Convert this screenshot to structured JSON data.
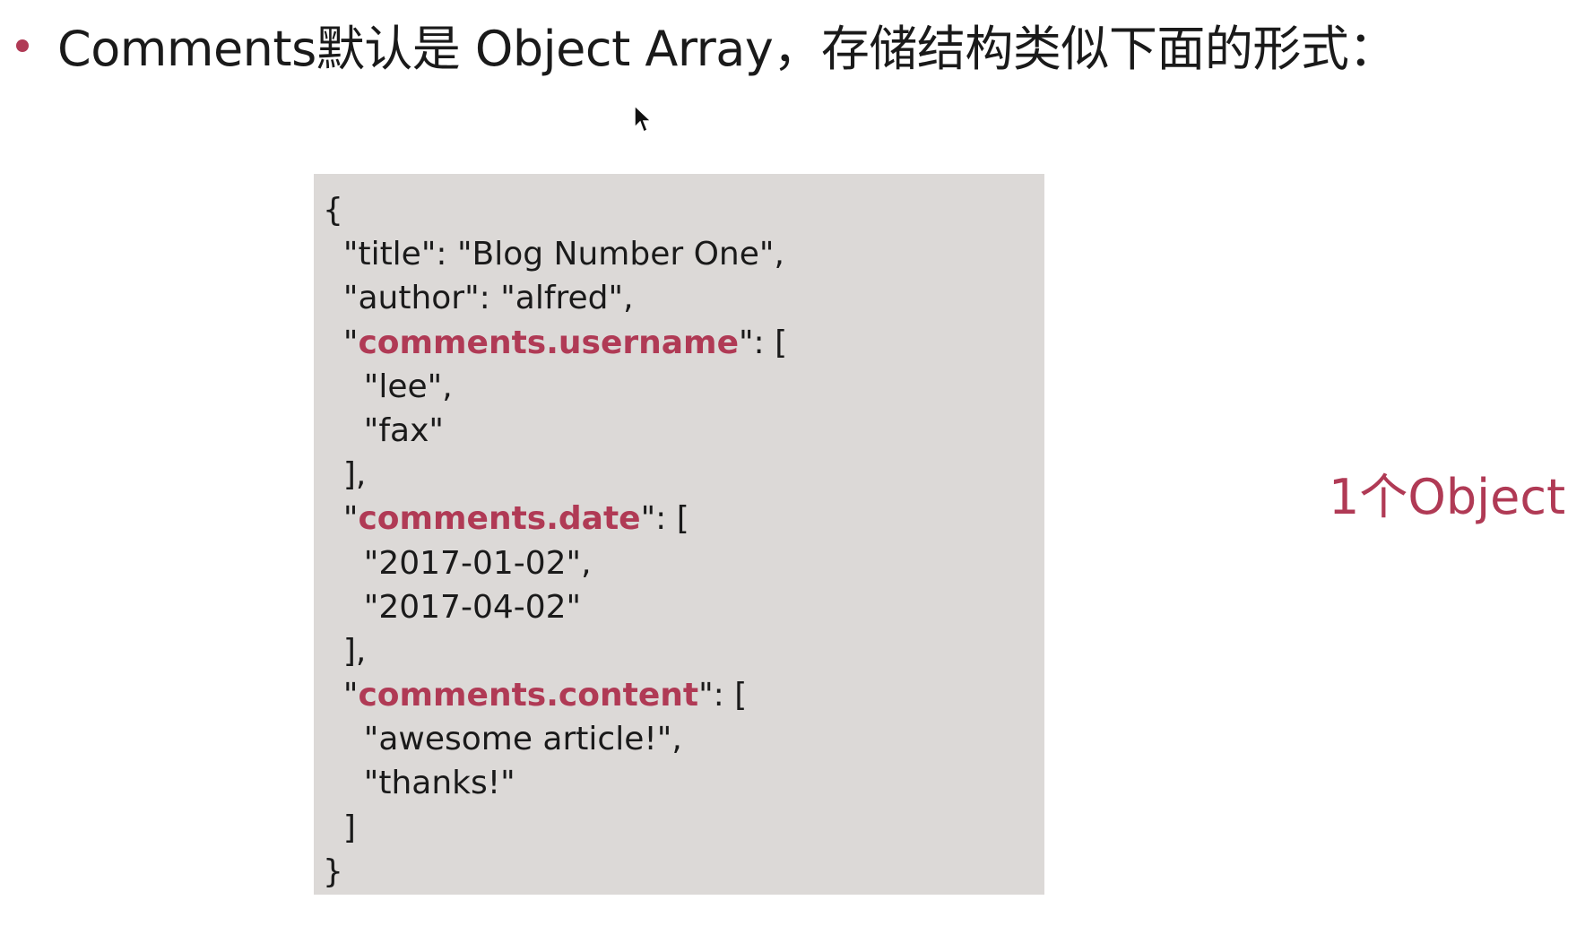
{
  "heading": "Comments默认是 Object Array，存储结构类似下面的形式：",
  "side_label": "1个Object",
  "colors": {
    "accent": "#b03a55",
    "code_bg": "#dcd9d7",
    "text": "#1a1a1a"
  },
  "code": {
    "lines": [
      {
        "indent": "",
        "pre": "{",
        "key": "",
        "post": ""
      },
      {
        "indent": "  ",
        "pre": "\"title\": \"Blog Number One\",",
        "key": "",
        "post": ""
      },
      {
        "indent": "  ",
        "pre": "\"author\": \"alfred\",",
        "key": "",
        "post": ""
      },
      {
        "indent": "  ",
        "pre": "\"",
        "key": "comments.username",
        "post": "\": ["
      },
      {
        "indent": "    ",
        "pre": "\"lee\",",
        "key": "",
        "post": ""
      },
      {
        "indent": "    ",
        "pre": "\"fax\"",
        "key": "",
        "post": ""
      },
      {
        "indent": "  ",
        "pre": "],",
        "key": "",
        "post": ""
      },
      {
        "indent": "  ",
        "pre": "\"",
        "key": "comments.date",
        "post": "\": ["
      },
      {
        "indent": "    ",
        "pre": "\"2017-01-02\",",
        "key": "",
        "post": ""
      },
      {
        "indent": "    ",
        "pre": "\"2017-04-02\"",
        "key": "",
        "post": ""
      },
      {
        "indent": "  ",
        "pre": "],",
        "key": "",
        "post": ""
      },
      {
        "indent": "  ",
        "pre": "\"",
        "key": "comments.content",
        "post": "\": ["
      },
      {
        "indent": "    ",
        "pre": "\"awesome article!\",",
        "key": "",
        "post": ""
      },
      {
        "indent": "    ",
        "pre": "\"thanks!\"",
        "key": "",
        "post": ""
      },
      {
        "indent": "  ",
        "pre": "]",
        "key": "",
        "post": ""
      },
      {
        "indent": "",
        "pre": "}",
        "key": "",
        "post": ""
      }
    ]
  }
}
